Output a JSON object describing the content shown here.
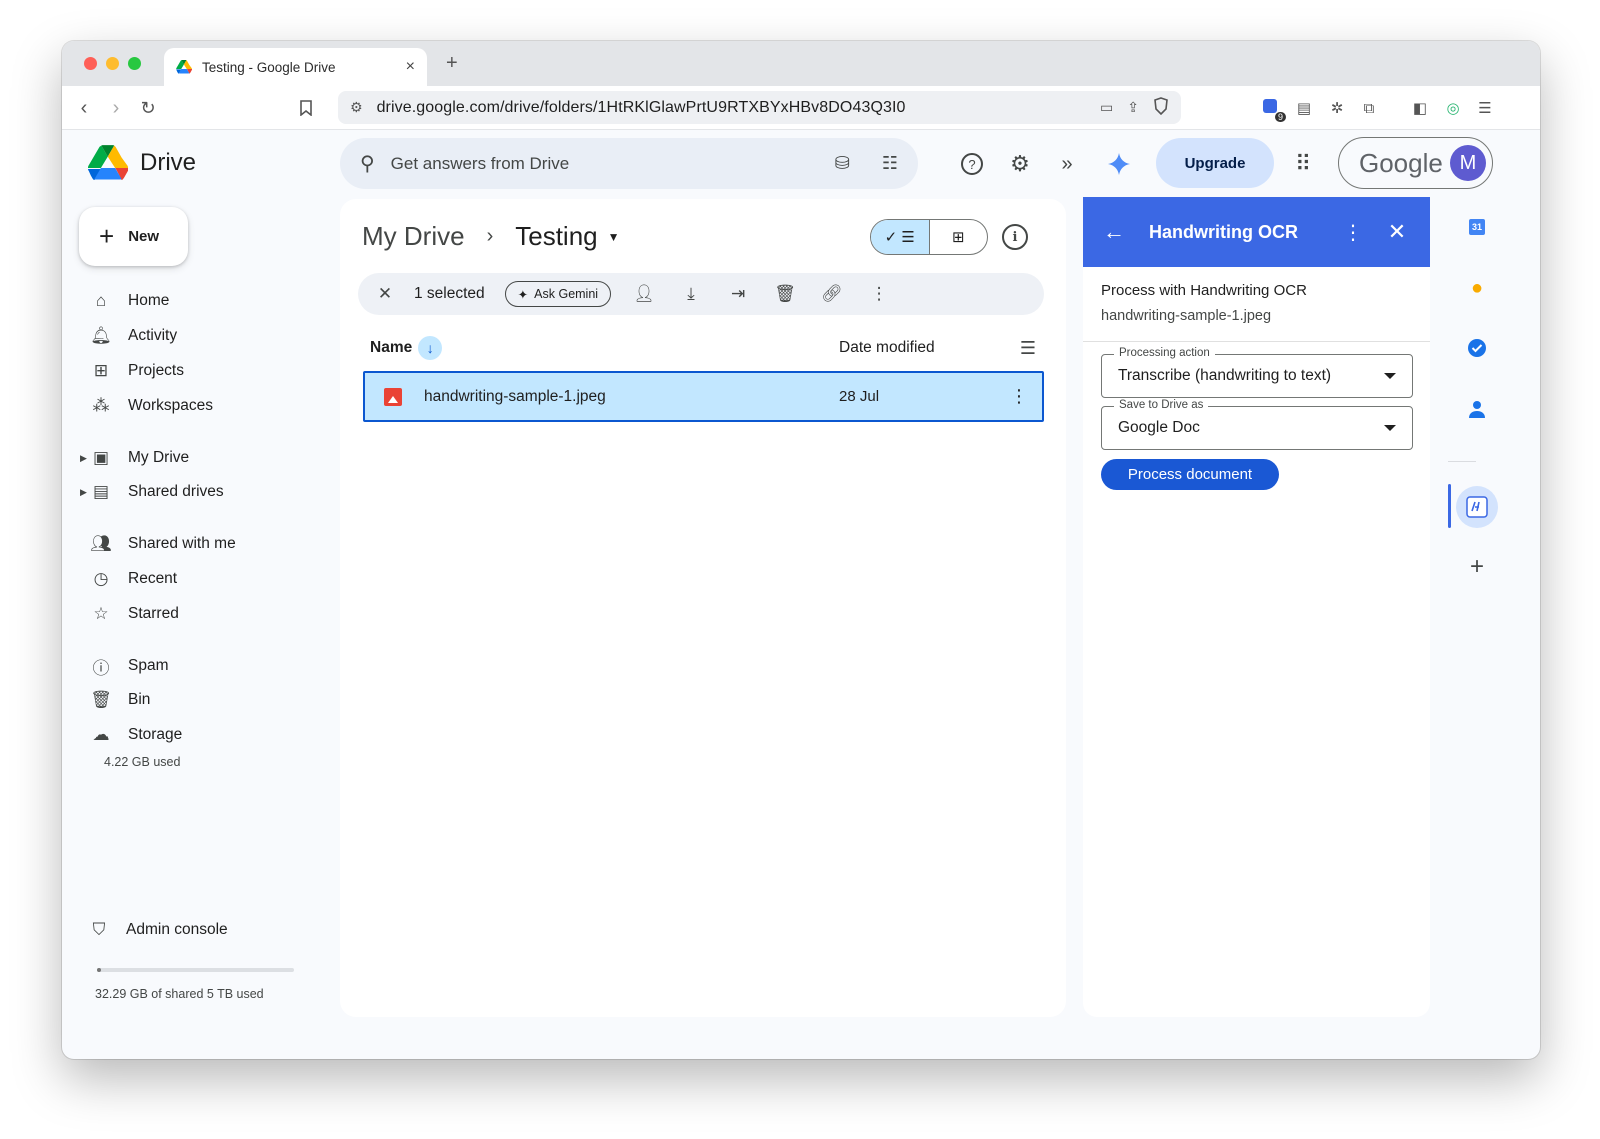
{
  "browser": {
    "tab_title": "Testing - Google Drive",
    "url": "drive.google.com/drive/folders/1HtRKlGlawPrtU9RTXBYxHBv8DO43Q3I0",
    "extension_badge": "9"
  },
  "header": {
    "app_name": "Drive",
    "search_placeholder": "Get answers from Drive",
    "upgrade_label": "Upgrade",
    "account_brand": "Google",
    "avatar_initial": "M"
  },
  "sidebar": {
    "new_label": "New",
    "items": [
      {
        "label": "Home",
        "icon": "home-icon"
      },
      {
        "label": "Activity",
        "icon": "bell-icon"
      },
      {
        "label": "Projects",
        "icon": "projects-icon"
      },
      {
        "label": "Workspaces",
        "icon": "workspaces-icon"
      },
      {
        "label": "My Drive",
        "icon": "my-drive-icon"
      },
      {
        "label": "Shared drives",
        "icon": "shared-drives-icon"
      },
      {
        "label": "Shared with me",
        "icon": "people-icon"
      },
      {
        "label": "Recent",
        "icon": "clock-icon"
      },
      {
        "label": "Starred",
        "icon": "star-icon"
      },
      {
        "label": "Spam",
        "icon": "spam-icon"
      },
      {
        "label": "Bin",
        "icon": "trash-icon"
      },
      {
        "label": "Storage",
        "icon": "cloud-icon"
      }
    ],
    "storage_used": "4.22 GB used",
    "admin_label": "Admin console",
    "shared_storage": "32.29 GB of shared 5 TB used",
    "shared_storage_fraction": 0.01
  },
  "main": {
    "breadcrumb_root": "My Drive",
    "breadcrumb_current": "Testing",
    "selection_count": "1 selected",
    "ask_gemini": "Ask Gemini",
    "col_name": "Name",
    "col_date": "Date modified",
    "files": [
      {
        "name": "handwriting-sample-1.jpeg",
        "date": "28 Jul",
        "selected": true
      }
    ]
  },
  "panel": {
    "title": "Handwriting OCR",
    "process_with": "Process with Handwriting OCR",
    "file_name": "handwriting-sample-1.jpeg",
    "action_label": "Processing action",
    "action_value": "Transcribe (handwriting to text)",
    "save_label": "Save to Drive as",
    "save_value": "Google Doc",
    "process_button": "Process document"
  },
  "rail": {
    "calendar_day": "31"
  },
  "colors": {
    "accent": "#0b57d0",
    "panel_header": "#3b68e4",
    "selection": "#c2e7ff",
    "upgrade_bg": "#d3e3fd"
  }
}
